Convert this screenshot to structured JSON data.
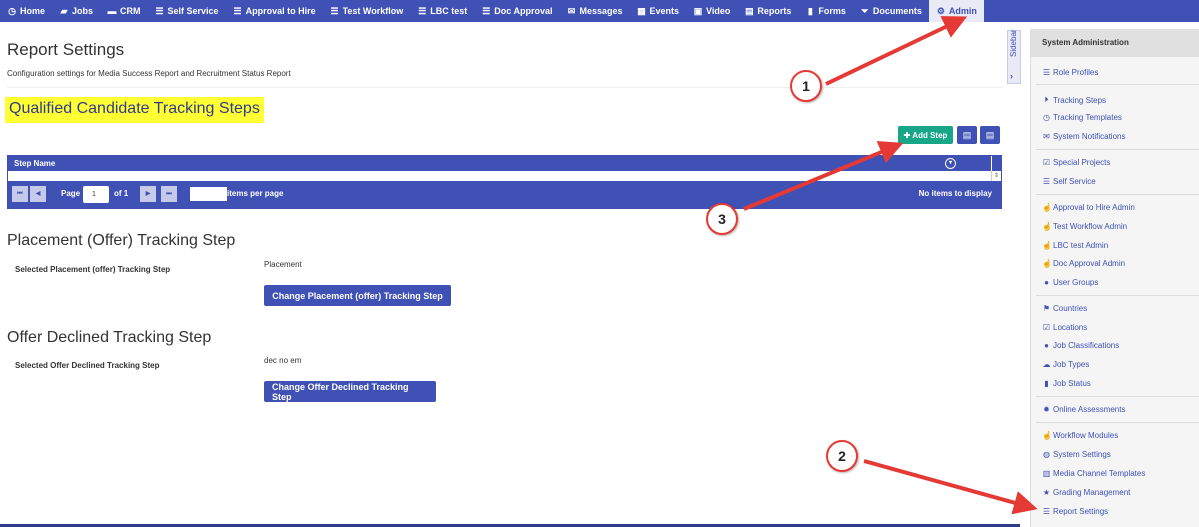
{
  "nav": {
    "items": [
      {
        "label": "Home",
        "icon": "clock-icon"
      },
      {
        "label": "Jobs",
        "icon": "folder-icon"
      },
      {
        "label": "CRM",
        "icon": "car-icon"
      },
      {
        "label": "Self Service",
        "icon": "list-icon"
      },
      {
        "label": "Approval to Hire",
        "icon": "list-icon"
      },
      {
        "label": "Test Workflow",
        "icon": "list-icon"
      },
      {
        "label": "LBC test",
        "icon": "list-icon"
      },
      {
        "label": "Doc Approval",
        "icon": "list-icon"
      },
      {
        "label": "Messages",
        "icon": "envelope-icon"
      },
      {
        "label": "Events",
        "icon": "calendar-icon"
      },
      {
        "label": "Video",
        "icon": "video-icon"
      },
      {
        "label": "Reports",
        "icon": "report-icon"
      },
      {
        "label": "Forms",
        "icon": "file-icon"
      },
      {
        "label": "Documents",
        "icon": "filter-icon"
      },
      {
        "label": "Admin",
        "icon": "gear-icon"
      }
    ]
  },
  "page": {
    "title": "Report Settings",
    "subtitle": "Configuration settings for Media Success Report and Recruitment Status Report"
  },
  "qualified": {
    "title": "Qualified Candidate Tracking Steps",
    "add_step_label": "Add Step",
    "grid_column": "Step Name",
    "pager_page": "Page",
    "pager_value": "1",
    "pager_of": "of 1",
    "items_per_page": "items per page",
    "no_items": "No items to display"
  },
  "placement": {
    "title": "Placement (Offer) Tracking Step",
    "label": "Selected Placement (offer) Tracking Step",
    "value": "Placement",
    "button": "Change Placement (offer) Tracking Step"
  },
  "declined": {
    "title": "Offer Declined Tracking Step",
    "label": "Selected Offer Declined Tracking Step",
    "value": "dec no em",
    "button": "Change Offer Declined Tracking Step"
  },
  "sidebar": {
    "toggle_label": "Sidebar",
    "title": "System Administration",
    "items": [
      {
        "label": "Role Profiles",
        "icon": "list-icon"
      },
      {
        "label": "Tracking Steps",
        "icon": "steps-icon"
      },
      {
        "label": "Tracking Templates",
        "icon": "clock-icon"
      },
      {
        "label": "System Notifications",
        "icon": "envelope-icon"
      },
      {
        "label": "Special Projects",
        "icon": "checkbox-icon"
      },
      {
        "label": "Self Service",
        "icon": "list-icon"
      },
      {
        "label": "Approval to Hire Admin",
        "icon": "thumbs-up-icon"
      },
      {
        "label": "Test Workflow Admin",
        "icon": "thumbs-up-icon"
      },
      {
        "label": "LBC test Admin",
        "icon": "thumbs-up-icon"
      },
      {
        "label": "Doc Approval Admin",
        "icon": "thumbs-up-icon"
      },
      {
        "label": "User Groups",
        "icon": "user-icon"
      },
      {
        "label": "Countries",
        "icon": "flag-icon"
      },
      {
        "label": "Locations",
        "icon": "checkbox-icon"
      },
      {
        "label": "Job Classifications",
        "icon": "user-icon"
      },
      {
        "label": "Job Types",
        "icon": "cloud-icon"
      },
      {
        "label": "Job Status",
        "icon": "document-icon"
      },
      {
        "label": "Online Assessments",
        "icon": "gear-icon"
      },
      {
        "label": "Workflow Modules",
        "icon": "thumbs-up-icon"
      },
      {
        "label": "System Settings",
        "icon": "globe-icon"
      },
      {
        "label": "Media Channel Templates",
        "icon": "book-icon"
      },
      {
        "label": "Grading Management",
        "icon": "star-icon"
      },
      {
        "label": "Report Settings",
        "icon": "list-icon"
      }
    ]
  },
  "annotations": [
    "1",
    "2",
    "3"
  ],
  "colors": {
    "primary": "#3f51b5",
    "highlight": "#ffff33",
    "add_button": "#18a689",
    "annotation": "#e53935"
  }
}
